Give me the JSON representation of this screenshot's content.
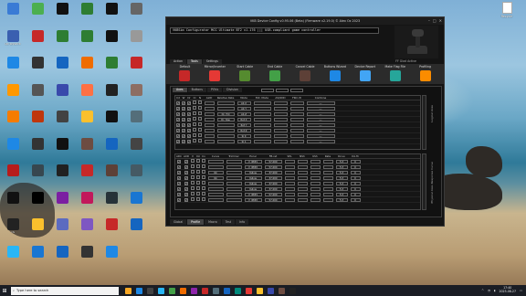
{
  "desktop": {
    "icons": [
      {
        "label": "",
        "color": "#3a7bd5"
      },
      {
        "label": "",
        "color": "#4caf50"
      },
      {
        "label": "",
        "color": "#111"
      },
      {
        "label": "",
        "color": "#2e7d32"
      },
      {
        "label": "",
        "color": "#111"
      },
      {
        "label": "",
        "color": "#666"
      },
      {
        "label": "Up Joystick",
        "color": "#3a5fb0"
      },
      {
        "label": "",
        "color": "#c62828"
      },
      {
        "label": "",
        "color": "#2e7d32"
      },
      {
        "label": "",
        "color": "#2e7d32"
      },
      {
        "label": "",
        "color": "#111"
      },
      {
        "label": "",
        "color": "#999"
      },
      {
        "label": "",
        "color": "#1e88e5"
      },
      {
        "label": "",
        "color": "#333"
      },
      {
        "label": "",
        "color": "#1565c0"
      },
      {
        "label": "",
        "color": "#ef6c00"
      },
      {
        "label": "",
        "color": "#2e7d32"
      },
      {
        "label": "",
        "color": "#c62828"
      },
      {
        "label": "",
        "color": "#ff9800"
      },
      {
        "label": "",
        "color": "#555"
      },
      {
        "label": "",
        "color": "#3949ab"
      },
      {
        "label": "",
        "color": "#ff7043"
      },
      {
        "label": "",
        "color": "#222"
      },
      {
        "label": "",
        "color": "#8d6e63"
      },
      {
        "label": "",
        "color": "#f57c00"
      },
      {
        "label": "",
        "color": "#bf360c"
      },
      {
        "label": "",
        "color": "#424242"
      },
      {
        "label": "",
        "color": "#fbc02d"
      },
      {
        "label": "",
        "color": "#111"
      },
      {
        "label": "",
        "color": "#546e7a"
      },
      {
        "label": "",
        "color": "#1e88e5"
      },
      {
        "label": "",
        "color": "#333"
      },
      {
        "label": "",
        "color": "#111"
      },
      {
        "label": "",
        "color": "#6d4c41"
      },
      {
        "label": "",
        "color": "#1565c0"
      },
      {
        "label": "",
        "color": "#444"
      },
      {
        "label": "",
        "color": "#b71c1c"
      },
      {
        "label": "",
        "color": "#37474f"
      },
      {
        "label": "",
        "color": "#212121"
      },
      {
        "label": "",
        "color": "#c62828"
      },
      {
        "label": "",
        "color": "#5d4037"
      },
      {
        "label": "",
        "color": "#455a64"
      },
      {
        "label": "",
        "color": "#111"
      },
      {
        "label": "",
        "color": "#000"
      },
      {
        "label": "",
        "color": "#7b1fa2"
      },
      {
        "label": "",
        "color": "#c2185b"
      },
      {
        "label": "",
        "color": "#263238"
      },
      {
        "label": "",
        "color": "#1976d2"
      },
      {
        "label": "TS",
        "color": "#222"
      },
      {
        "label": "",
        "color": "#fbc02d"
      },
      {
        "label": "",
        "color": "#5c6bc0"
      },
      {
        "label": "",
        "color": "#7e57c2"
      },
      {
        "label": "",
        "color": "#c62828"
      },
      {
        "label": "",
        "color": "#1565c0"
      },
      {
        "label": "",
        "color": "#29b6f6"
      },
      {
        "label": "",
        "color": "#1976d2"
      },
      {
        "label": "",
        "color": "#1565c0"
      },
      {
        "label": "",
        "color": "#333"
      },
      {
        "label": "",
        "color": "#1e88e5"
      }
    ],
    "recycle_label": "Recycle"
  },
  "window": {
    "title": "VKB Device Config v0.95.06 (Beta) (Firmware v2.19.0) © Alex Oz 2023",
    "config_name": "VKBSim Configurator MCG Ultimate BT2 v1.176    ||| USB-compliant game controller",
    "ribbon_tabs": [
      "Action",
      "Tools",
      "Settings"
    ],
    "active_ribbon_tab": "Tools",
    "ff_label": "FF Glad Active",
    "ribbon_buttons": [
      {
        "label": "Default",
        "color": "#c62828"
      },
      {
        "label": "Mirror/Inverter",
        "color": "#e53935"
      },
      {
        "label": "Start Cable",
        "color": "#558b2f"
      },
      {
        "label": "End Cable",
        "color": "#43a047"
      },
      {
        "label": "Cancel Cable",
        "color": "#5d4037"
      },
      {
        "label": "Buttons Wizard",
        "color": "#1e88e5"
      },
      {
        "label": "Device Report",
        "color": "#42a5f5"
      },
      {
        "label": "Make Flag File",
        "color": "#26a69a"
      },
      {
        "label": "Profiling",
        "color": "#fb8c00"
      }
    ],
    "sub_tabs": [
      "Axes",
      "Buttons",
      "POVs",
      "Division"
    ],
    "active_sub_tab": "Axes",
    "bottom_tabs": [
      "Global",
      "Profile",
      "Macro",
      "Test",
      "Info"
    ],
    "active_bottom_tab": "Profile",
    "side_label_top": "Logical Axes",
    "side_label_bottom": "Physical Axes\nResponse Curve",
    "upper_headers": [
      "Cd",
      "W",
      "Dr",
      "Cl",
      "N",
      "AxID",
      "Relative Rate",
      "Mode",
      "Ext. Mode",
      "AS/ODD",
      "FKO ctl",
      "Combine"
    ],
    "upper_rows": [
      {
        "axid": "",
        "rel": "",
        "mode": "Ab X",
        "ext": "",
        "as": "",
        "fko": "",
        "combine": "---"
      },
      {
        "axid": "",
        "rel": "",
        "mode": "Ab Y",
        "ext": "",
        "as": "",
        "fko": "",
        "combine": "---"
      },
      {
        "axid": "",
        "rel": "Dr. Ytd",
        "mode": "Ab Z",
        "ext": "",
        "as": "",
        "fko": "",
        "combine": "---"
      },
      {
        "axid": "",
        "rel": "Dr. Yaw",
        "mode": "Rot X",
        "ext": "",
        "as": "",
        "fko": "",
        "combine": "---"
      },
      {
        "axid": "",
        "rel": "",
        "mode": "Rot Y",
        "ext": "",
        "as": "",
        "fko": "",
        "combine": "---"
      },
      {
        "axid": "",
        "rel": "",
        "mode": "Rot Z",
        "ext": "",
        "as": "",
        "fko": "",
        "combine": "---"
      },
      {
        "axid": "",
        "rel": "",
        "mode": "Sl 0",
        "ext": "",
        "as": "",
        "fko": "",
        "combine": "---"
      },
      {
        "axid": "",
        "rel": "",
        "mode": "Sl 1",
        "ext": "",
        "as": "",
        "fko": "",
        "combine": "---"
      }
    ],
    "lower_headers": [
      "ADC",
      "AXD",
      "V",
      "Dz",
      "Cn",
      "Curve",
      "Trimmer",
      "Excel",
      "FB-ret",
      "SPL",
      "NSh",
      "KSh",
      "Rate",
      "Dz.Lo",
      "Dz.Hi"
    ],
    "lower_rows": [
      {
        "curve": "",
        "trim": "",
        "excel": "V_IMIP1",
        "fb": "57.000",
        "spl": "",
        "nsh": "",
        "ksh": "",
        "rate": "",
        "dzlo": "5.3",
        "dzhi": "0"
      },
      {
        "curve": "",
        "trim": "",
        "excel": "V_IMIP2",
        "fb": "57.000",
        "spl": "",
        "nsh": "",
        "ksh": "",
        "rate": "",
        "dzlo": "5.3",
        "dzhi": "0"
      },
      {
        "curve": "Ok",
        "trim": "",
        "excel": "Yellow",
        "fb": "37.000",
        "spl": "",
        "nsh": "",
        "ksh": "",
        "rate": "",
        "dzlo": "5.3",
        "dzhi": "0"
      },
      {
        "curve": "Ok",
        "trim": "",
        "excel": "Yellow",
        "fb": "37.000",
        "spl": "",
        "nsh": "",
        "ksh": "",
        "rate": "",
        "dzlo": "5.3",
        "dzhi": "0"
      },
      {
        "curve": "",
        "trim": "",
        "excel": "Yellow",
        "fb": "37.000",
        "spl": "",
        "nsh": "",
        "ksh": "",
        "rate": "",
        "dzlo": "5.3",
        "dzhi": "0"
      },
      {
        "curve": "",
        "trim": "",
        "excel": "Yellow",
        "fb": "37.000",
        "spl": "",
        "nsh": "",
        "ksh": "",
        "rate": "",
        "dzlo": "5.3",
        "dzhi": "0"
      },
      {
        "curve": "",
        "trim": "",
        "excel": "V_IMIP1",
        "fb": "57.000",
        "spl": "",
        "nsh": "",
        "ksh": "",
        "rate": "",
        "dzlo": "5.3",
        "dzhi": "0"
      },
      {
        "curve": "",
        "trim": "",
        "excel": "V_IMIP2",
        "fb": "57.000",
        "spl": "",
        "nsh": "",
        "ksh": "",
        "rate": "",
        "dzlo": "5.3",
        "dzhi": "0"
      }
    ]
  },
  "taskbar": {
    "search_placeholder": "Type here to search",
    "apps": [
      "#f9a825",
      "#1e88e5",
      "#424242",
      "#29b6f6",
      "#43a047",
      "#ef6c00",
      "#8e24aa",
      "#c62828",
      "#546e7a",
      "#1565c0",
      "#00897b",
      "#e53935",
      "#fbc02d",
      "#3949ab",
      "#6d4c41",
      "#222"
    ],
    "time": "17:40",
    "date": "2023-08-27"
  }
}
